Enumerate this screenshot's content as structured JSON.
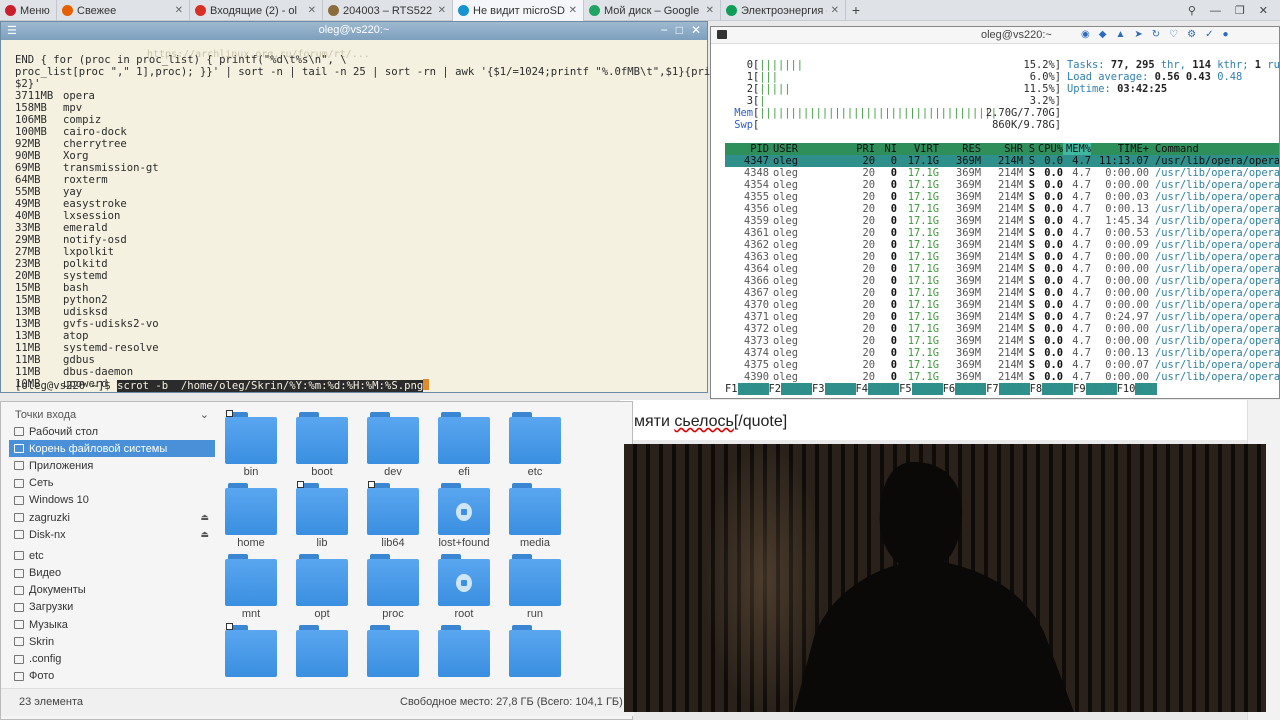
{
  "browser": {
    "tabs": [
      {
        "label": "Меню",
        "icon": "opera-icon",
        "color": "#cc1f2d"
      },
      {
        "label": "Свежее",
        "icon": "firefox-icon",
        "color": "#e66000"
      },
      {
        "label": "Входящие (2) - ol",
        "icon": "gmail-icon",
        "color": "#d93025"
      },
      {
        "label": "204003 – RTS522",
        "icon": "page-icon",
        "color": "#8a6d3b"
      },
      {
        "label": "Не видит microSD",
        "icon": "arch-icon",
        "color": "#1793d1",
        "active": true
      },
      {
        "label": "Мой диск – Google",
        "icon": "gdrive-icon",
        "color": "#1fa463"
      },
      {
        "label": "Электроэнергия с",
        "icon": "sheets-icon",
        "color": "#0f9d58"
      }
    ],
    "new_tab": "+",
    "ghost_url": "https://archlinux.org.ru/forum/rt/..."
  },
  "behind_page": {
    "text_before": "мяти ",
    "text_underlined": "сьелось",
    "text_after": "[/quote]"
  },
  "terminal": {
    "title": "oleg@vs220:~",
    "command_lines": [
      "END { for (proc in proc_list) { printf(\"%d\\t%s\\n\", \\",
      "proc_list[proc \",\" 1],proc); }}' | sort -n | tail -n 25 | sort -rn | awk '{$1/=1024;printf \"%.0fMB\\t\",$1}{print",
      "$2}'"
    ],
    "rows": [
      [
        "3711MB",
        "opera"
      ],
      [
        "158MB",
        "mpv"
      ],
      [
        "106MB",
        "compiz"
      ],
      [
        "100MB",
        "cairo-dock"
      ],
      [
        "92MB",
        "cherrytree"
      ],
      [
        "90MB",
        "Xorg"
      ],
      [
        "69MB",
        "transmission-gt"
      ],
      [
        "64MB",
        "roxterm"
      ],
      [
        "55MB",
        "yay"
      ],
      [
        "49MB",
        "easystroke"
      ],
      [
        "40MB",
        "lxsession"
      ],
      [
        "33MB",
        "emerald"
      ],
      [
        "29MB",
        "notify-osd"
      ],
      [
        "27MB",
        "lxpolkit"
      ],
      [
        "23MB",
        "polkitd"
      ],
      [
        "20MB",
        "systemd"
      ],
      [
        "15MB",
        "bash"
      ],
      [
        "15MB",
        "python2"
      ],
      [
        "13MB",
        "udisksd"
      ],
      [
        "13MB",
        "gvfs-udisks2-vo"
      ],
      [
        "13MB",
        "atop"
      ],
      [
        "11MB",
        "systemd-resolve"
      ],
      [
        "11MB",
        "gdbus"
      ],
      [
        "11MB",
        "dbus-daemon"
      ],
      [
        "10MB",
        "upowerd"
      ]
    ],
    "prompt": "[oleg@vs220 ~]$ ",
    "current_command": "scrot -b  /home/oleg/Skrin/%Y:%m:%d:%H:%M:%S.png"
  },
  "htop": {
    "title": "oleg@vs220:~",
    "cpus": [
      {
        "id": "0",
        "bar": "|||||||",
        "pct": "15.2%]"
      },
      {
        "id": "1",
        "bar": "|||",
        "pct": "6.0%]"
      },
      {
        "id": "2",
        "bar": "|||||",
        "pct": "11.5%]"
      },
      {
        "id": "3",
        "bar": "|",
        "pct": "3.2%]"
      }
    ],
    "mem": {
      "label": "Mem",
      "bar": "||||||||||||||||||||||||||||||||||||||",
      "value": "2.70G/7.70G]"
    },
    "swp": {
      "label": "Swp",
      "bar": "",
      "value": "860K/9.78G]"
    },
    "tasks": {
      "label": "Tasks:",
      "tasks": "77,",
      "thr": "295",
      "thr_label": "thr,",
      "kthr": "114",
      "kthr_label": "kthr;",
      "running": "1",
      "running_label": "runn"
    },
    "load": {
      "label": "Load average:",
      "v1": "0.56",
      "v2": "0.43",
      "v3": "0.48"
    },
    "uptime": {
      "label": "Uptime:",
      "value": "03:42:25"
    },
    "header": [
      "PID",
      "USER",
      "PRI",
      "NI",
      "VIRT",
      "RES",
      "SHR",
      "S",
      "CPU%",
      "MEM%",
      "TIME+",
      "Command"
    ],
    "rows": [
      [
        "4347",
        "oleg",
        "20",
        "0",
        "17.1G",
        "369M",
        "214M",
        "S",
        "0.0",
        "4.7",
        "11:13.07",
        "/usr/lib/opera/opera --enabl"
      ],
      [
        "4348",
        "oleg",
        "20",
        "0",
        "17.1G",
        "369M",
        "214M",
        "S",
        "0.0",
        "4.7",
        "0:00.00",
        "/usr/lib/opera/opera --enabl"
      ],
      [
        "4354",
        "oleg",
        "20",
        "0",
        "17.1G",
        "369M",
        "214M",
        "S",
        "0.0",
        "4.7",
        "0:00.00",
        "/usr/lib/opera/opera --enabl"
      ],
      [
        "4355",
        "oleg",
        "20",
        "0",
        "17.1G",
        "369M",
        "214M",
        "S",
        "0.0",
        "4.7",
        "0:00.03",
        "/usr/lib/opera/opera --enabl"
      ],
      [
        "4356",
        "oleg",
        "20",
        "0",
        "17.1G",
        "369M",
        "214M",
        "S",
        "0.0",
        "4.7",
        "0:00.13",
        "/usr/lib/opera/opera --enabl"
      ],
      [
        "4359",
        "oleg",
        "20",
        "0",
        "17.1G",
        "369M",
        "214M",
        "S",
        "0.0",
        "4.7",
        "1:45.34",
        "/usr/lib/opera/opera --enabl"
      ],
      [
        "4361",
        "oleg",
        "20",
        "0",
        "17.1G",
        "369M",
        "214M",
        "S",
        "0.0",
        "4.7",
        "0:00.53",
        "/usr/lib/opera/opera --enabl"
      ],
      [
        "4362",
        "oleg",
        "20",
        "0",
        "17.1G",
        "369M",
        "214M",
        "S",
        "0.0",
        "4.7",
        "0:00.09",
        "/usr/lib/opera/opera --enabl"
      ],
      [
        "4363",
        "oleg",
        "20",
        "0",
        "17.1G",
        "369M",
        "214M",
        "S",
        "0.0",
        "4.7",
        "0:00.00",
        "/usr/lib/opera/opera --enabl"
      ],
      [
        "4364",
        "oleg",
        "20",
        "0",
        "17.1G",
        "369M",
        "214M",
        "S",
        "0.0",
        "4.7",
        "0:00.00",
        "/usr/lib/opera/opera --enabl"
      ],
      [
        "4366",
        "oleg",
        "20",
        "0",
        "17.1G",
        "369M",
        "214M",
        "S",
        "0.0",
        "4.7",
        "0:00.00",
        "/usr/lib/opera/opera --enabl"
      ],
      [
        "4367",
        "oleg",
        "20",
        "0",
        "17.1G",
        "369M",
        "214M",
        "S",
        "0.0",
        "4.7",
        "0:00.00",
        "/usr/lib/opera/opera --enabl"
      ],
      [
        "4370",
        "oleg",
        "20",
        "0",
        "17.1G",
        "369M",
        "214M",
        "S",
        "0.0",
        "4.7",
        "0:00.00",
        "/usr/lib/opera/opera --enabl"
      ],
      [
        "4371",
        "oleg",
        "20",
        "0",
        "17.1G",
        "369M",
        "214M",
        "S",
        "0.0",
        "4.7",
        "0:24.97",
        "/usr/lib/opera/opera --enabl"
      ],
      [
        "4372",
        "oleg",
        "20",
        "0",
        "17.1G",
        "369M",
        "214M",
        "S",
        "0.0",
        "4.7",
        "0:00.00",
        "/usr/lib/opera/opera --enabl"
      ],
      [
        "4373",
        "oleg",
        "20",
        "0",
        "17.1G",
        "369M",
        "214M",
        "S",
        "0.0",
        "4.7",
        "0:00.00",
        "/usr/lib/opera/opera --enabl"
      ],
      [
        "4374",
        "oleg",
        "20",
        "0",
        "17.1G",
        "369M",
        "214M",
        "S",
        "0.0",
        "4.7",
        "0:00.13",
        "/usr/lib/opera/opera --enabl"
      ],
      [
        "4375",
        "oleg",
        "20",
        "0",
        "17.1G",
        "369M",
        "214M",
        "S",
        "0.0",
        "4.7",
        "0:00.07",
        "/usr/lib/opera/opera --enabl"
      ],
      [
        "4390",
        "oleg",
        "20",
        "0",
        "17.1G",
        "369M",
        "214M",
        "S",
        "0.0",
        "4.7",
        "0:00.00",
        "/usr/lib/opera/opera --enabl"
      ]
    ],
    "fkeys": [
      {
        "k": "F1",
        "v": "Help"
      },
      {
        "k": "F2",
        "v": "Setup"
      },
      {
        "k": "F3",
        "v": "Search"
      },
      {
        "k": "F4",
        "v": "Filter"
      },
      {
        "k": "F5",
        "v": "Tree"
      },
      {
        "k": "F6",
        "v": "SortBy"
      },
      {
        "k": "F7",
        "v": "Nice -"
      },
      {
        "k": "F8",
        "v": "Nice +"
      },
      {
        "k": "F9",
        "v": "Kill"
      },
      {
        "k": "F10",
        "v": "Quit"
      }
    ]
  },
  "file_manager": {
    "sidebar_header": "Точки входа",
    "sidebar": [
      {
        "label": "Рабочий стол"
      },
      {
        "label": "Корень файловой системы",
        "selected": true
      },
      {
        "label": "Приложения"
      },
      {
        "label": "Сеть"
      },
      {
        "label": "Windows 10"
      },
      {
        "label": "zagruzki",
        "eject": true
      },
      {
        "label": "Disk-nx",
        "eject": true
      },
      {
        "label": "etc"
      },
      {
        "label": "Видео"
      },
      {
        "label": "Документы"
      },
      {
        "label": "Загрузки"
      },
      {
        "label": "Музыка"
      },
      {
        "label": "Skrin"
      },
      {
        "label": ".config"
      },
      {
        "label": "Фото"
      }
    ],
    "folders": [
      {
        "name": "bin",
        "link": true
      },
      {
        "name": "boot"
      },
      {
        "name": "dev"
      },
      {
        "name": "efi"
      },
      {
        "name": "etc"
      },
      {
        "name": "home"
      },
      {
        "name": "lib",
        "link": true
      },
      {
        "name": "lib64",
        "link": true
      },
      {
        "name": "lost+found",
        "locked": true
      },
      {
        "name": "media"
      },
      {
        "name": "mnt"
      },
      {
        "name": "opt"
      },
      {
        "name": "proc"
      },
      {
        "name": "root",
        "locked": true
      },
      {
        "name": "run"
      },
      {
        "name": "",
        "link": true
      },
      {
        "name": ""
      },
      {
        "name": ""
      },
      {
        "name": ""
      },
      {
        "name": ""
      }
    ],
    "status_count": "23 элемента",
    "status_free": "Свободное место: 27,8 ГБ (Всего: 104,1 ГБ)"
  }
}
